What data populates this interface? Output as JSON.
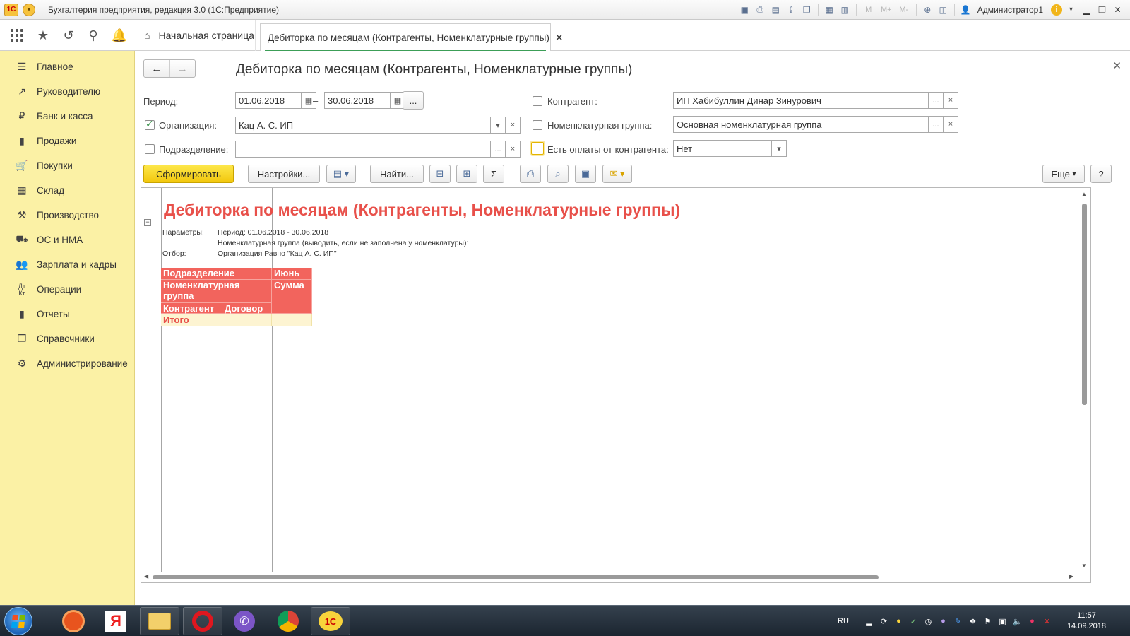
{
  "window": {
    "title": "Бухгалтерия предприятия, редакция 3.0 (1С:Предприятие)",
    "logo_text": "1С",
    "user": "Администратор1",
    "m_buttons": [
      "M",
      "M+",
      "M-"
    ]
  },
  "tabs": {
    "home": "Начальная страница",
    "active": "Дебиторка по месяцам (Контрагенты, Номенклатурные группы)"
  },
  "sidebar": {
    "items": [
      {
        "label": "Главное",
        "icon": "menu-icon"
      },
      {
        "label": "Руководителю",
        "icon": "trend-icon"
      },
      {
        "label": "Банк и касса",
        "icon": "ruble-icon"
      },
      {
        "label": "Продажи",
        "icon": "sales-icon"
      },
      {
        "label": "Покупки",
        "icon": "cart-icon"
      },
      {
        "label": "Склад",
        "icon": "warehouse-icon"
      },
      {
        "label": "Производство",
        "icon": "production-icon"
      },
      {
        "label": "ОС и НМА",
        "icon": "truck-icon"
      },
      {
        "label": "Зарплата и кадры",
        "icon": "people-icon"
      },
      {
        "label": "Операции",
        "icon": "operations-icon"
      },
      {
        "label": "Отчеты",
        "icon": "chart-icon"
      },
      {
        "label": "Справочники",
        "icon": "book-icon"
      },
      {
        "label": "Администрирование",
        "icon": "gear-icon"
      }
    ]
  },
  "form": {
    "title": "Дебиторка по месяцам (Контрагенты, Номенклатурные группы)",
    "period_label": "Период:",
    "period_from": "01.06.2018",
    "period_dash": "–",
    "period_to": "30.06.2018",
    "organization_label": "Организация:",
    "organization_value": "Кац А. С. ИП",
    "organization_checked": true,
    "subdivision_label": "Подразделение:",
    "subdivision_value": "",
    "subdivision_checked": false,
    "counterparty_label": "Контрагент:",
    "counterparty_value": "ИП Хабибуллин Динар Зинурович",
    "counterparty_checked": false,
    "nomgroup_label": "Номенклатурная группа:",
    "nomgroup_value": "Основная номенклатурная группа",
    "nomgroup_checked": false,
    "payments_label": "Есть оплаты от контрагента:",
    "payments_value": "Нет",
    "payments_checked": false,
    "ellipsis": "...",
    "clear": "×",
    "dropdown": "▾"
  },
  "toolbar": {
    "generate": "Сформировать",
    "settings": "Настройки...",
    "find": "Найти...",
    "sum": "Σ",
    "more": "Еще",
    "help": "?"
  },
  "report": {
    "title": "Дебиторка по месяцам (Контрагенты, Номенклатурные группы)",
    "params_label": "Параметры:",
    "params_line1": "Период: 01.06.2018 - 30.06.2018",
    "params_line2": "Номенклатурная группа (выводить, если не заполнена у номенклатуры):",
    "filter_label": "Отбор:",
    "filter_value": "Организация Равно \"Кац А. С. ИП\"",
    "group_toggle": "−",
    "header": {
      "subdivision": "Подразделение",
      "month": "Июнь",
      "nomgroup": "Номенклатурная группа",
      "sum": "Сумма",
      "counterparty": "Контрагент",
      "contract": "Договор"
    },
    "total": "Итого"
  },
  "taskbar": {
    "lang": "RU",
    "time": "11:57",
    "date": "14.09.2018",
    "apps": [
      "media-player",
      "yandex-browser",
      "file-explorer",
      "opera",
      "viber",
      "chrome",
      "1c-enterprise"
    ]
  }
}
